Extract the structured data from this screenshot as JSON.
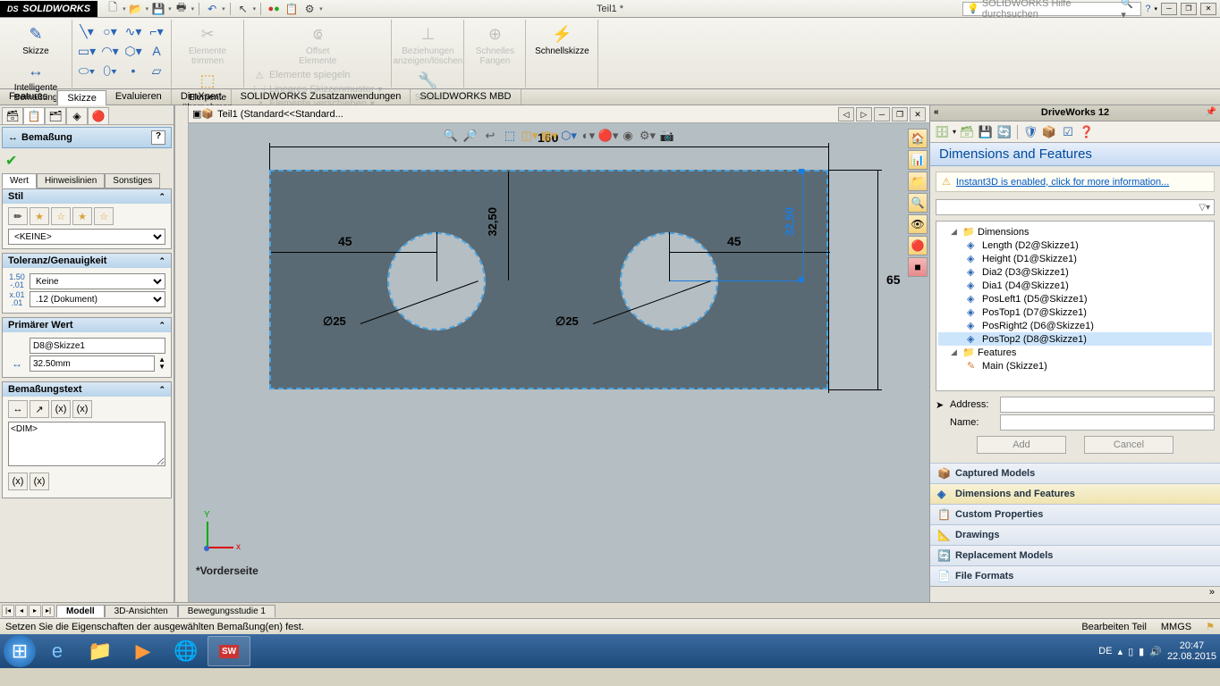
{
  "app": {
    "name": "SOLIDWORKS",
    "doc_title": "Teil1 *",
    "search_placeholder": "SOLIDWORKS Hilfe durchsuchen"
  },
  "ribbon": {
    "skizze": "Skizze",
    "intelligente_bemassung": "Intelligente\nBemaßung",
    "elemente_trimmen": "Elemente\ntrimmen",
    "elemente_uebernehmen": "Elemente\nübernehmen",
    "offset_elemente": "Offset\nElemente",
    "spiegeln": "Elemente spiegeln",
    "skizzenmuster": "Lineares Skizzenmuster",
    "verschieben": "Elemente verschieben",
    "beziehungen": "Beziehungen\nanzeigen/löschen",
    "skizze_reparieren": "Skizze\nreparieren",
    "schnelles_fangen": "Schnelles\nFangen",
    "schnellskizze": "Schnellskizze"
  },
  "tabs": {
    "features": "Features",
    "skizze": "Skizze",
    "evaluieren": "Evaluieren",
    "dimxpert": "DimXpert",
    "zusatz": "SOLIDWORKS Zusatzanwendungen",
    "mbd": "SOLIDWORKS MBD"
  },
  "pm": {
    "title": "Bemaßung",
    "tab_wert": "Wert",
    "tab_hinweis": "Hinweislinien",
    "tab_sonst": "Sonstiges",
    "stil": "Stil",
    "stil_select": "<KEINE>",
    "tol": "Toleranz/Genauigkeit",
    "tol_select": "Keine",
    "prec_select": ".12 (Dokument)",
    "prim": "Primärer Wert",
    "prim_name": "D8@Skizze1",
    "prim_val": "32.50mm",
    "dimtext": "Bemaßungstext",
    "dimtext_val": "<DIM>"
  },
  "breadcrumb": "Teil1  (Standard<<Standard...",
  "viewname": "*Vorderseite",
  "sketch": {
    "width": "160",
    "height": "65",
    "offset_l": "45",
    "offset_r": "45",
    "offset_v1": "32,50",
    "offset_v2": "32,50",
    "dia1": "∅25",
    "dia2": "∅25"
  },
  "dw": {
    "title": "DriveWorks 12",
    "subtitle": "Dimensions and Features",
    "warn": "Instant3D is enabled, click for more information...",
    "tree": {
      "dims": "Dimensions",
      "items": [
        "Length (D2@Skizze1)",
        "Height (D1@Skizze1)",
        "Dia2 (D3@Skizze1)",
        "Dia1 (D4@Skizze1)",
        "PosLeft1 (D5@Skizze1)",
        "PosTop1 (D7@Skizze1)",
        "PosRight2 (D6@Skizze1)",
        "PosTop2 (D8@Skizze1)"
      ],
      "feats": "Features",
      "feat_items": [
        "Main (Skizze1)"
      ]
    },
    "address": "Address:",
    "name": "Name:",
    "add": "Add",
    "cancel": "Cancel",
    "acc": [
      "Captured Models",
      "Dimensions and Features",
      "Custom Properties",
      "Drawings",
      "Replacement Models",
      "File Formats"
    ]
  },
  "bottom": {
    "modell": "Modell",
    "ansichten": "3D-Ansichten",
    "bewegung": "Bewegungsstudie 1"
  },
  "status": {
    "msg": "Setzen Sie die Eigenschaften der ausgewählten Bemaßung(en) fest.",
    "mode": "Bearbeiten Teil",
    "units": "MMGS"
  },
  "tray": {
    "lang": "DE",
    "time": "20:47",
    "date": "22.08.2015"
  },
  "triad": {
    "x": "x",
    "y": "Y"
  }
}
